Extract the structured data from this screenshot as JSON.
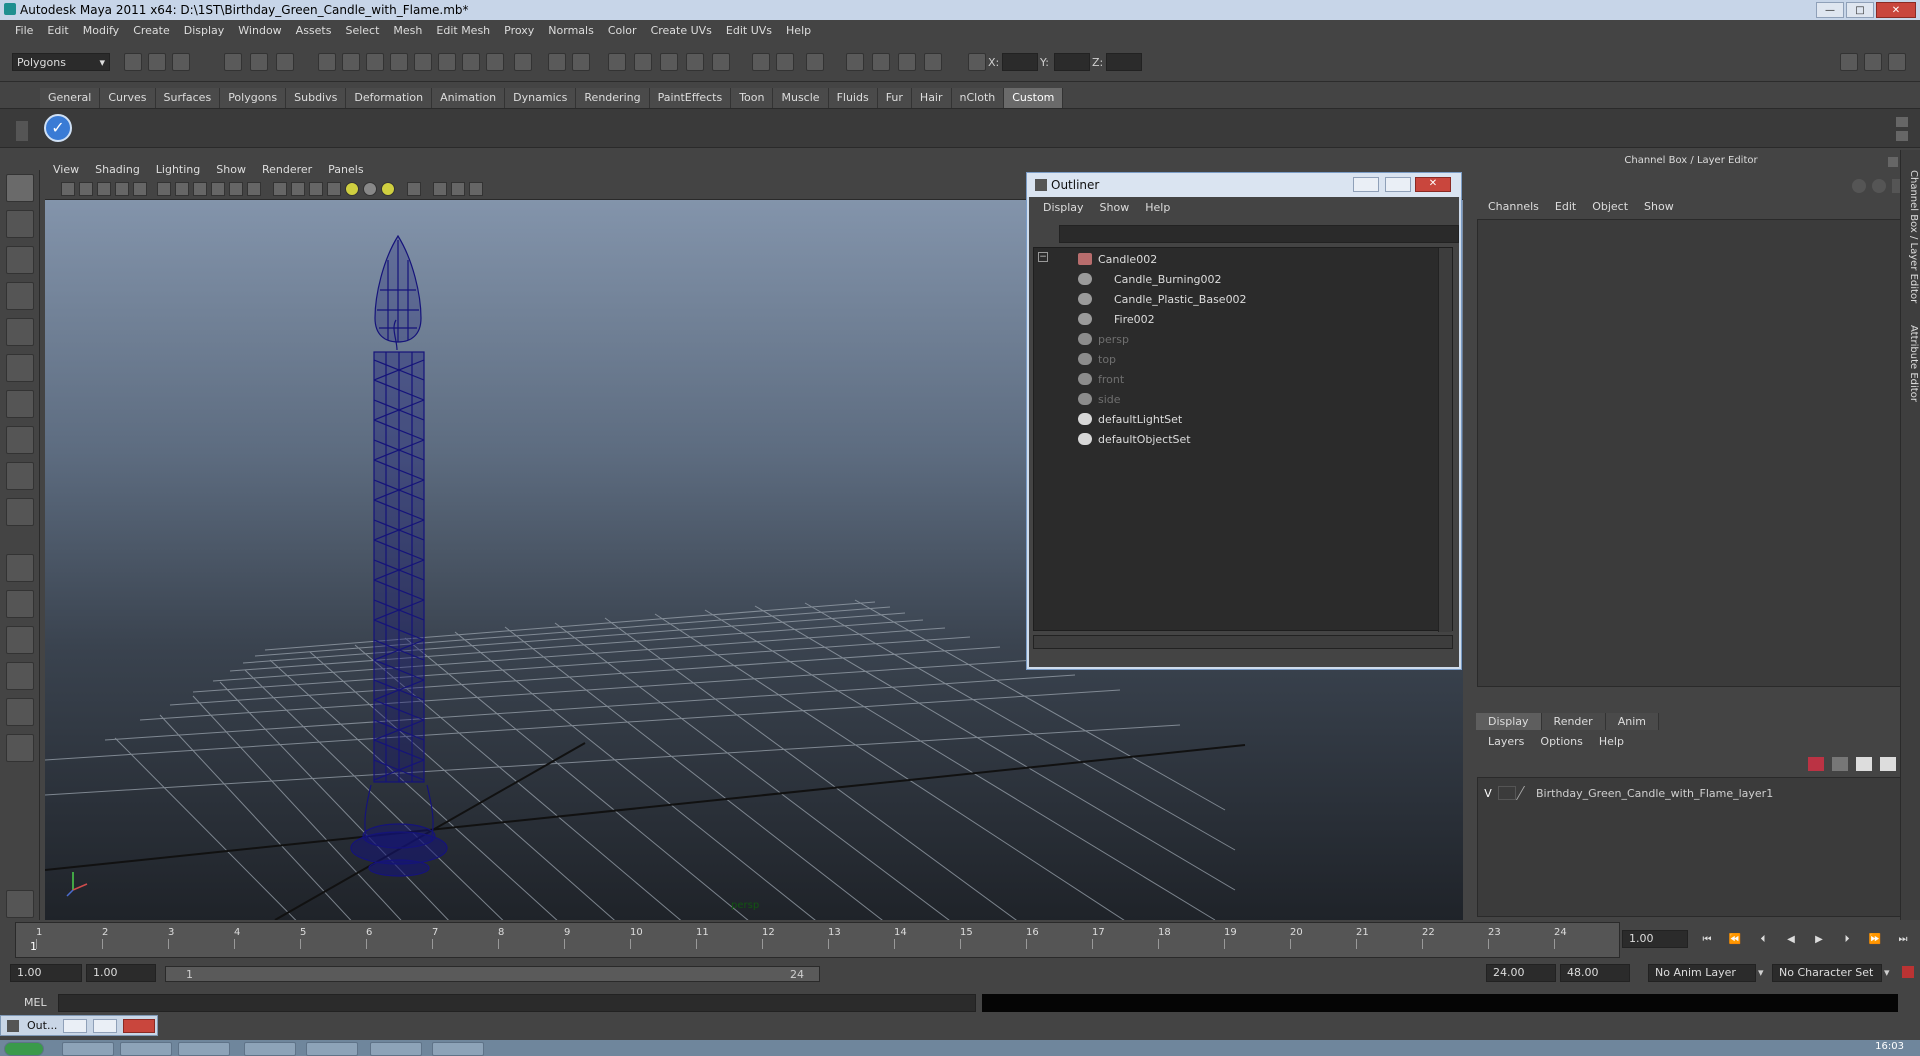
{
  "window": {
    "title": "Autodesk Maya 2011 x64: D:\\1ST\\Birthday_Green_Candle_with_Flame.mb*",
    "min": "—",
    "max": "□",
    "close": "✕"
  },
  "menubar": [
    "File",
    "Edit",
    "Modify",
    "Create",
    "Display",
    "Window",
    "Assets",
    "Select",
    "Mesh",
    "Edit Mesh",
    "Proxy",
    "Normals",
    "Color",
    "Create UVs",
    "Edit UVs",
    "Help"
  ],
  "toolbar": {
    "mode": "Polygons",
    "x_label": "X:",
    "y_label": "Y:",
    "z_label": "Z:"
  },
  "shelf_tabs": [
    "General",
    "Curves",
    "Surfaces",
    "Polygons",
    "Subdivs",
    "Deformation",
    "Animation",
    "Dynamics",
    "Rendering",
    "PaintEffects",
    "Toon",
    "Muscle",
    "Fluids",
    "Fur",
    "Hair",
    "nCloth",
    "Custom"
  ],
  "shelf_tabs_active": "Custom",
  "panel_menu": [
    "View",
    "Shading",
    "Lighting",
    "Show",
    "Renderer",
    "Panels"
  ],
  "viewport": {
    "camera_label": "persp"
  },
  "outliner": {
    "title": "Outliner",
    "menu": [
      "Display",
      "Show",
      "Help"
    ],
    "items": [
      {
        "label": "Candle002",
        "type": "group",
        "dim": false
      },
      {
        "label": "Candle_Burning002",
        "type": "mesh",
        "dim": false
      },
      {
        "label": "Candle_Plastic_Base002",
        "type": "mesh",
        "dim": false
      },
      {
        "label": "Fire002",
        "type": "mesh",
        "dim": false
      },
      {
        "label": "persp",
        "type": "camera",
        "dim": true
      },
      {
        "label": "top",
        "type": "camera",
        "dim": true
      },
      {
        "label": "front",
        "type": "camera",
        "dim": true
      },
      {
        "label": "side",
        "type": "camera",
        "dim": true
      },
      {
        "label": "defaultLightSet",
        "type": "set",
        "dim": false
      },
      {
        "label": "defaultObjectSet",
        "type": "set",
        "dim": false
      }
    ]
  },
  "channel_box": {
    "title": "Channel Box / Layer Editor",
    "menu": [
      "Channels",
      "Edit",
      "Object",
      "Show"
    ],
    "layer_tabs": [
      "Display",
      "Render",
      "Anim"
    ],
    "layer_tabs_active": "Display",
    "layer_menu": [
      "Layers",
      "Options",
      "Help"
    ],
    "layer": {
      "visible": "V",
      "name": "Birthday_Green_Candle_with_Flame_layer1"
    }
  },
  "side_tabs": [
    "Channel Box / Layer Editor",
    "Attribute Editor"
  ],
  "timeline": {
    "ticks": [
      "1",
      "2",
      "3",
      "4",
      "5",
      "6",
      "7",
      "8",
      "9",
      "10",
      "11",
      "12",
      "13",
      "14",
      "15",
      "16",
      "17",
      "18",
      "19",
      "20",
      "21",
      "22",
      "23",
      "24"
    ],
    "current_frame": "1",
    "current_field": "1.00"
  },
  "range": {
    "start": "1.00",
    "start2": "1.00",
    "slider_start": "1",
    "slider_end": "24",
    "end": "24.00",
    "end2": "48.00",
    "anim_layer": "No Anim Layer",
    "char_set": "No Character Set"
  },
  "mel": {
    "label": "MEL"
  },
  "minimized_window": {
    "label": "Out..."
  },
  "clock": "16:03"
}
